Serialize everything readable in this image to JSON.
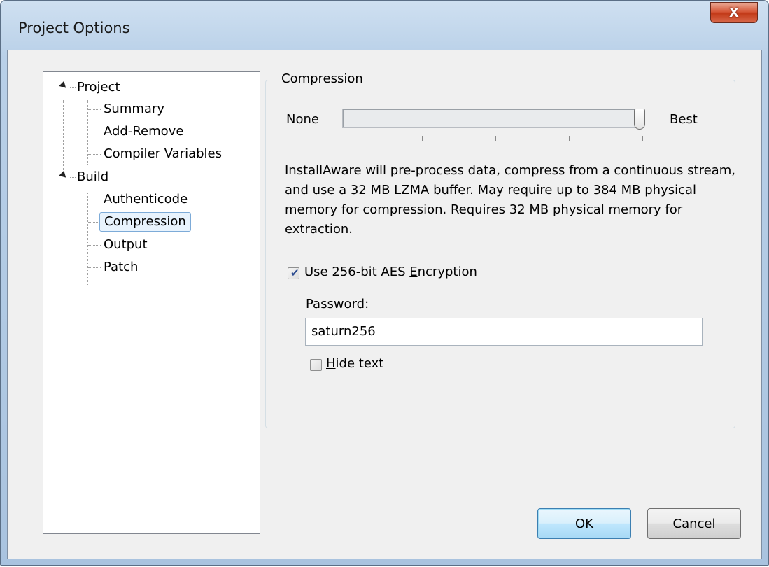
{
  "window": {
    "title": "Project Options",
    "close_label": "X"
  },
  "tree": {
    "project": {
      "label": "Project",
      "children": [
        "Summary",
        "Add-Remove",
        "Compiler Variables"
      ]
    },
    "build": {
      "label": "Build",
      "children": [
        "Authenticode",
        "Compression",
        "Output",
        "Patch"
      ]
    },
    "selected": "Compression"
  },
  "compression": {
    "group_label": "Compression",
    "slider_min_label": "None",
    "slider_max_label": "Best",
    "slider_level": 1.0,
    "description": "InstallAware will pre-process data, compress from a continuous stream, and use a 32 MB LZMA buffer. May require up to 384 MB physical memory for compression. Requires 32 MB physical memory for extraction.",
    "aes_checkbox": {
      "label_before": "Use 256-bit AES ",
      "label_accel": "E",
      "label_after": "ncryption",
      "checked": true
    },
    "password_label_accel": "P",
    "password_label_rest": "assword:",
    "password_value": "saturn256",
    "hide_text_checkbox": {
      "label_accel": "H",
      "label_rest": "ide text",
      "checked": false
    }
  },
  "buttons": {
    "ok": "OK",
    "cancel": "Cancel"
  }
}
